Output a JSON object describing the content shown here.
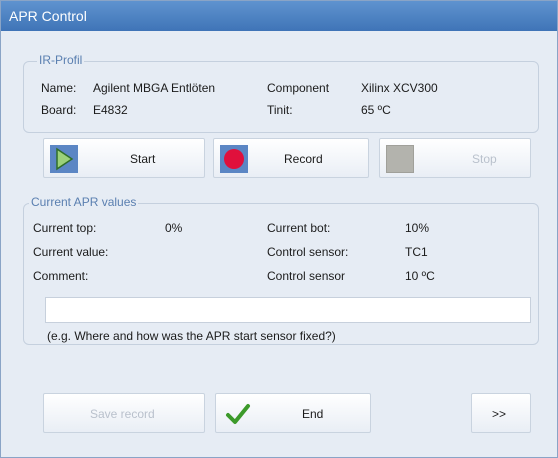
{
  "window": {
    "title": "APR Control"
  },
  "ir_profile": {
    "group_label": "IR-Profil",
    "name_label": "Name:",
    "name_value": "Agilent MBGA Entlöten",
    "component_label": "Component",
    "component_value": "Xilinx XCV300",
    "board_label": "Board:",
    "board_value": "E4832",
    "tinit_label": "Tinit:",
    "tinit_value": "65 ºC"
  },
  "controls": {
    "start_label": "Start",
    "record_label": "Record",
    "stop_label": "Stop"
  },
  "apr_values": {
    "group_label": "Current APR values",
    "current_top_label": "Current top:",
    "current_top_value": "0%",
    "current_bot_label": "Current bot:",
    "current_bot_value": "10%",
    "current_value_label": "Current value:",
    "control_sensor_label": "Control sensor:",
    "control_sensor_value": "TC1",
    "comment_label": "Comment:",
    "control_sensor2_label": "Control sensor",
    "control_sensor2_value": "10 ºC",
    "comment_input_value": "",
    "comment_hint": "(e.g. Where and how was the APR start sensor fixed?)"
  },
  "footer": {
    "save_label": "Save record",
    "end_label": "End",
    "next_label": ">>"
  },
  "colors": {
    "title_bar": "#4a80c0",
    "record_icon": "#e0103c",
    "end_check": "#3c9a2a"
  },
  "icons": {
    "start": "play-triangle-icon",
    "record": "red-circle-icon",
    "stop": "gray-square-icon",
    "end": "checkmark-icon"
  }
}
